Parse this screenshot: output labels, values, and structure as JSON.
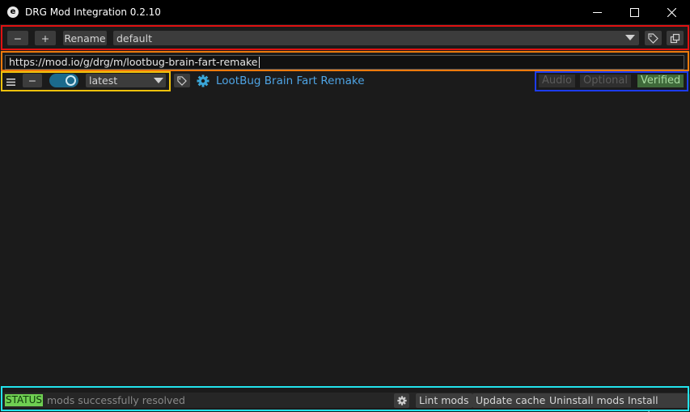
{
  "window": {
    "app_icon_letter": "e",
    "title": "DRG Mod Integration 0.2.10"
  },
  "profile": {
    "remove_label": "−",
    "add_label": "+",
    "rename_label": "Rename",
    "selected_profile": "default"
  },
  "url_input": {
    "value": "https://mod.io/g/drg/m/lootbug-brain-fart-remake"
  },
  "mod": {
    "enabled": true,
    "version": "latest",
    "name": "LootBug Brain Fart Remake",
    "tags": {
      "audio": "Audio",
      "optional": "Optional",
      "verified": "Verified"
    }
  },
  "status": {
    "label": "STATUS",
    "message": "mods successfully resolved",
    "buttons": {
      "lint": "Lint mods",
      "update_cache": "Update cache",
      "uninstall": "Uninstall mods",
      "install": "Install mods"
    }
  },
  "colors": {
    "highlight_profile_row": "#e01212",
    "highlight_url_row": "#f07a0c",
    "highlight_mod_controls": "#f0c20c",
    "highlight_mod_tags": "#1d3cf0",
    "highlight_status_bar": "#22e3ec",
    "mod_link": "#4ea3e3",
    "status_label_bg": "#6fcf52",
    "verified_tag_bg": "#3f6a3a"
  }
}
